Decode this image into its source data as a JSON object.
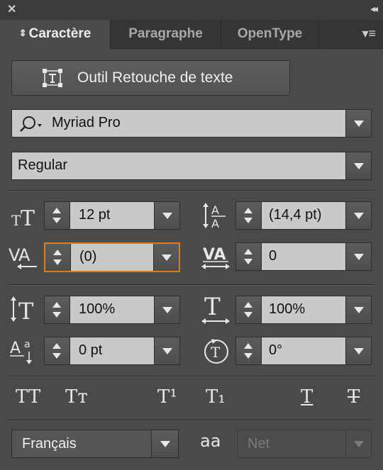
{
  "window": {
    "close_glyph": "✕",
    "collapse_glyph": "◂◂",
    "menu_glyph": "▾≡"
  },
  "tabs": [
    {
      "label": "Caractère",
      "active": true,
      "updown_glyph": "⇕"
    },
    {
      "label": "Paragraphe",
      "active": false
    },
    {
      "label": "OpenType",
      "active": false
    }
  ],
  "retouche_button": {
    "label": "Outil Retouche de texte",
    "icon": "text-touch-icon"
  },
  "font_family": {
    "value": "Myriad Pro",
    "icon": "search-icon"
  },
  "font_style": {
    "value": "Regular"
  },
  "size": {
    "value": "12 pt",
    "icon": "font-size-icon"
  },
  "leading": {
    "value": "(14,4 pt)",
    "icon": "leading-icon"
  },
  "kerning": {
    "value": "(0)",
    "icon": "kerning-icon"
  },
  "tracking": {
    "value": "0",
    "icon": "tracking-icon"
  },
  "vertical_scale": {
    "value": "100%",
    "icon": "vertical-scale-icon"
  },
  "horizontal_scale": {
    "value": "100%",
    "icon": "horizontal-scale-icon"
  },
  "baseline_shift": {
    "value": "0 pt",
    "icon": "baseline-shift-icon"
  },
  "rotation": {
    "value": "0°",
    "icon": "character-rotation-icon"
  },
  "style_buttons": {
    "all_caps": "TT",
    "small_caps": "Tт",
    "superscript": "T¹",
    "subscript": "T₁",
    "underline": "T",
    "strikethrough": "T"
  },
  "language": {
    "value": "Français"
  },
  "antialias": {
    "value": "Net",
    "icon_label": "aa"
  },
  "colors": {
    "accent_focus": "#e07a1a",
    "panel_bg": "#4a4a4a",
    "field_bg": "#c9c9c9"
  }
}
